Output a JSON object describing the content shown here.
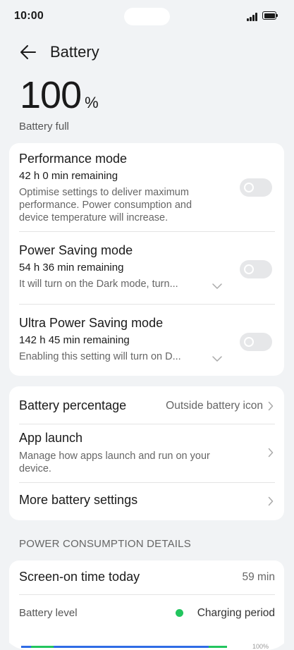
{
  "status_bar": {
    "time": "10:00"
  },
  "header": {
    "title": "Battery"
  },
  "battery": {
    "level": "100",
    "unit": "%",
    "status": "Battery full"
  },
  "modes": [
    {
      "title": "Performance mode",
      "remaining": "42 h 0 min remaining",
      "description_lines": [
        "Optimise settings to deliver maximum",
        "performance. Power consumption and",
        "device temperature will increase."
      ],
      "enabled": false
    },
    {
      "title": "Power Saving mode",
      "remaining": "54 h 36 min remaining",
      "description": "It will turn on the Dark mode, turn...",
      "enabled": false
    },
    {
      "title": "Ultra Power Saving mode",
      "remaining": "142 h 45 min remaining",
      "description": "Enabling this setting will turn on D...",
      "enabled": false
    }
  ],
  "settings": {
    "battery_percentage": {
      "label": "Battery percentage",
      "value": "Outside battery icon"
    },
    "app_launch": {
      "label": "App launch",
      "description_lines": [
        "Manage how apps launch and run on your",
        "device."
      ]
    },
    "more": {
      "label": "More battery settings"
    }
  },
  "details": {
    "section_header": "POWER CONSUMPTION DETAILS",
    "screen_on": {
      "label": "Screen-on time today",
      "value": "59 min"
    },
    "battery_level": {
      "label": "Battery level",
      "legend": "Charging period",
      "legend_color": "#22c55e"
    },
    "axis_label": "100%"
  },
  "colors": {
    "accent": "#2f6ce5",
    "charging": "#22c55e",
    "background": "#f1f3f5"
  }
}
